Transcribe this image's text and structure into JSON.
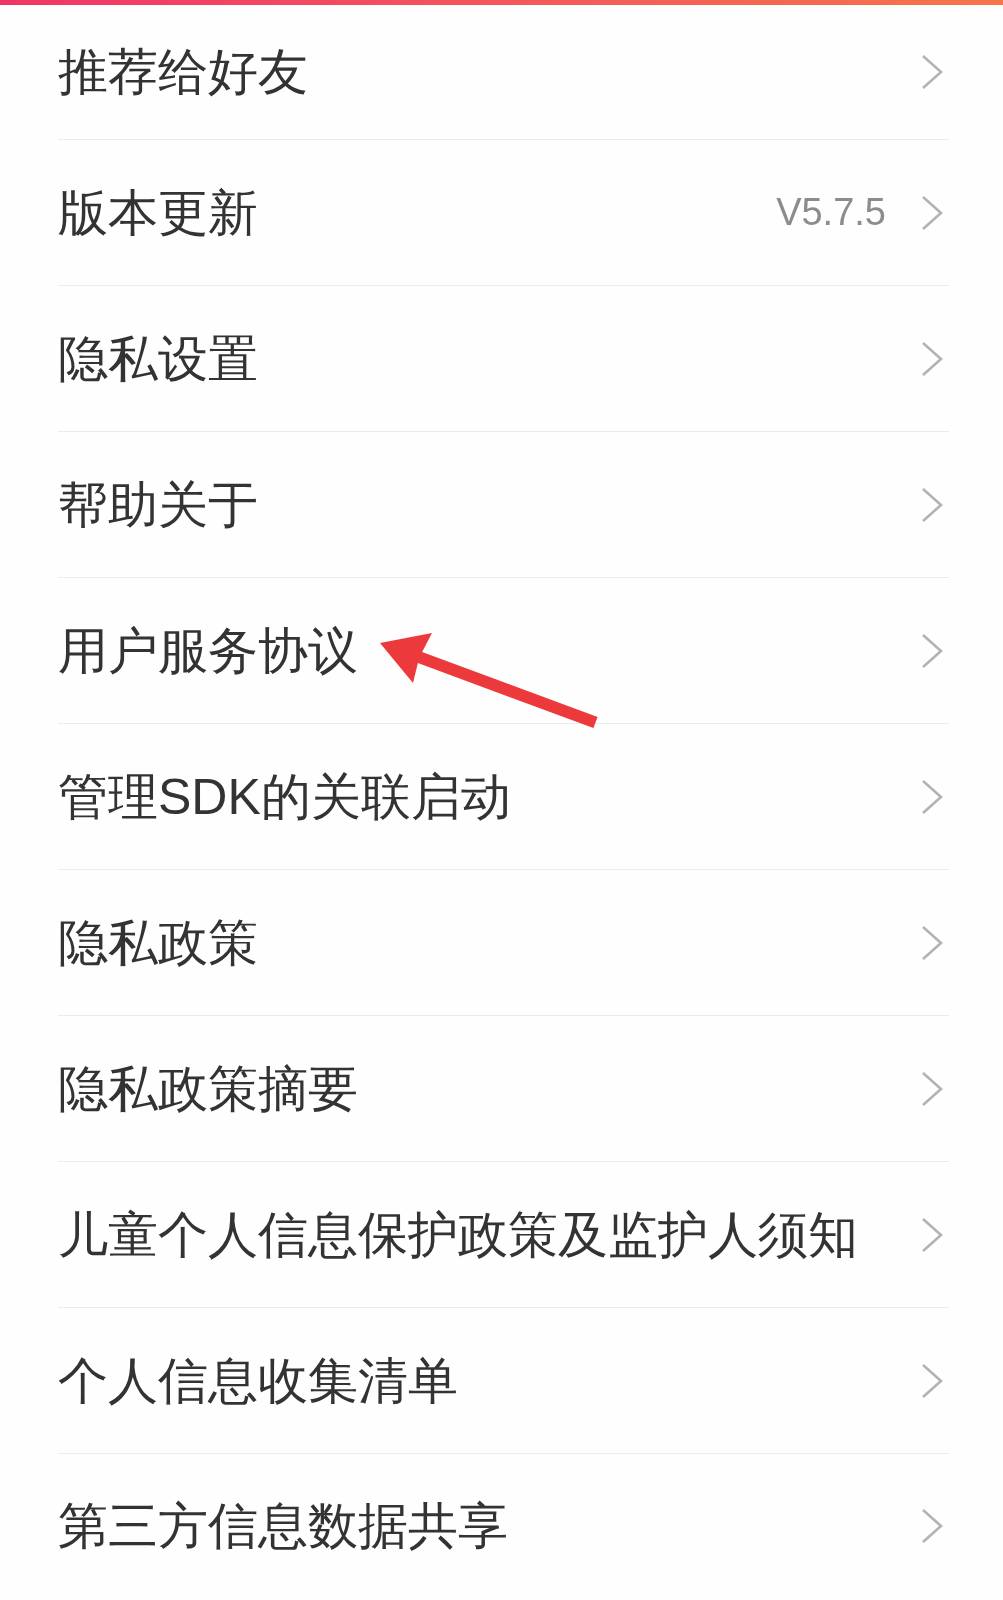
{
  "menu": [
    {
      "label": "推荐给好友",
      "marked": false
    },
    {
      "label": "版本更新",
      "value": "V5.7.5",
      "marked": false
    },
    {
      "label": "隐私设置",
      "marked": false
    },
    {
      "label": "帮助关于",
      "marked": false
    },
    {
      "label": "用户服务协议",
      "marked": true
    },
    {
      "label": "管理SDK的关联启动",
      "marked": false
    },
    {
      "label": "隐私政策",
      "marked": false
    },
    {
      "label": "隐私政策摘要",
      "marked": false
    },
    {
      "label": "儿童个人信息保护政策及监护人须知",
      "marked": false
    },
    {
      "label": "个人信息收集清单",
      "marked": false
    },
    {
      "label": "第三方信息数据共享",
      "marked": false
    }
  ]
}
